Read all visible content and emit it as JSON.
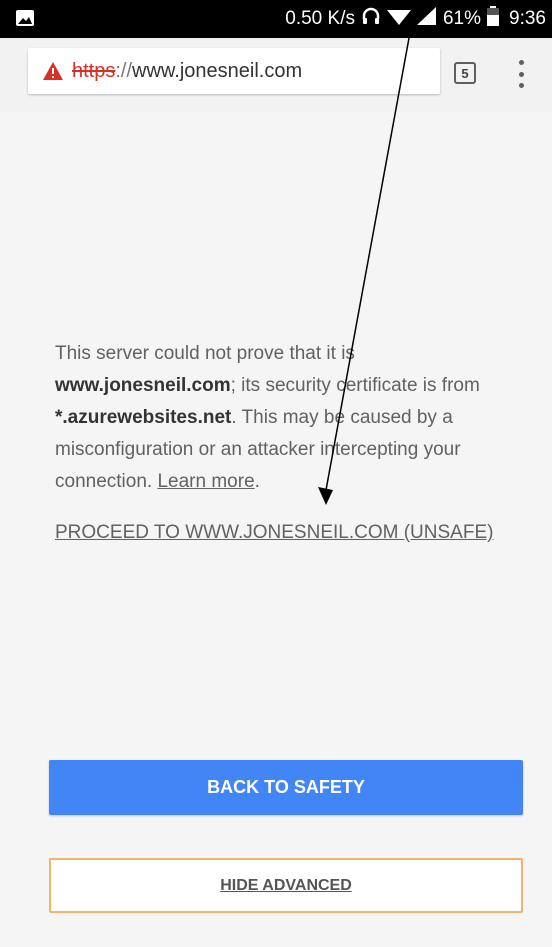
{
  "status_bar": {
    "speed": "0.50 K/s",
    "battery": "61%",
    "time": "9:36",
    "icons": [
      "image-icon",
      "headphones-icon",
      "wifi-icon",
      "signal-icon",
      "battery-icon"
    ]
  },
  "toolbar": {
    "url_scheme": "https",
    "url_sep": "://",
    "url_host": "www.jonesneil.com",
    "tab_count": "5"
  },
  "message": {
    "part1": "This server could not prove that it is ",
    "domain": "www.jonesneil.com",
    "part2": "; its security certificate is from ",
    "cert": "*.azurewebsites.net",
    "part3": ". This may be caused by a misconfiguration or an attacker intercepting your connection. ",
    "learn_more": "Learn more",
    "part4": "."
  },
  "proceed_link": "PROCEED TO WWW.JONESNEIL.COM (UNSAFE)",
  "buttons": {
    "back_to_safety": "BACK TO SAFETY",
    "hide_advanced": "HIDE ADVANCED"
  },
  "colors": {
    "primary_button": "#4285f4",
    "warning": "#d93025",
    "hide_border": "#f6b26b"
  }
}
